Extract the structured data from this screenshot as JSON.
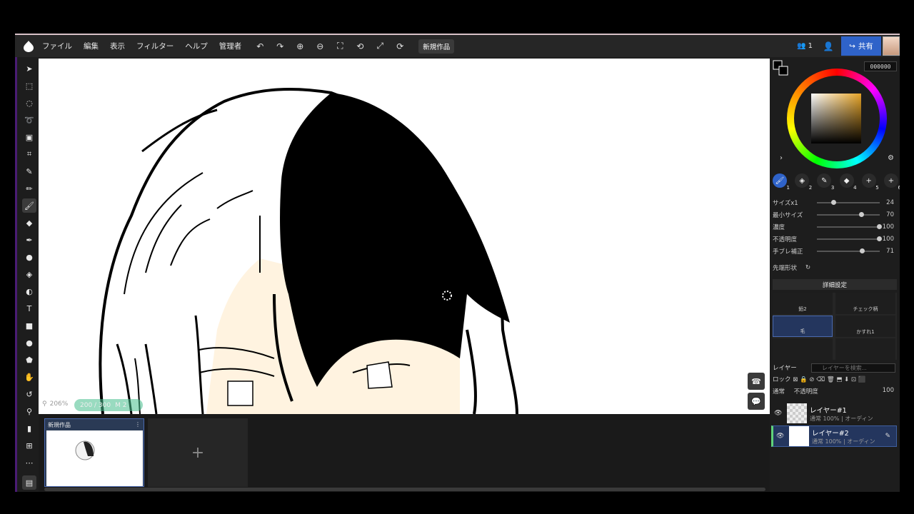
{
  "menu": {
    "items": [
      "ファイル",
      "編集",
      "表示",
      "フィルター",
      "ヘルプ",
      "管理者"
    ],
    "doc_title": "新規作品"
  },
  "header": {
    "user_count": "1",
    "share_label": "共有"
  },
  "canvas": {
    "zoom": "206%",
    "brush_size_pill": "200 / 300",
    "brush_mode": "M 2"
  },
  "works": {
    "thumb_title": "新規作品",
    "add_label": "+"
  },
  "color": {
    "hex": "000000",
    "accent": "#2f63c9"
  },
  "brush_tabs": [
    {
      "icon": "brush-icon",
      "num": "1"
    },
    {
      "icon": "fill-icon",
      "num": "2"
    },
    {
      "icon": "pen-icon",
      "num": "3"
    },
    {
      "icon": "eraser-icon",
      "num": "4"
    },
    {
      "icon": "add-icon",
      "num": "5"
    },
    {
      "icon": "add-icon",
      "num": "6"
    }
  ],
  "sliders": [
    {
      "label": "サイズx1",
      "value": "24",
      "level": 0.24
    },
    {
      "label": "最小サイズ",
      "value": "70",
      "level": 0.7
    },
    {
      "label": "濃度",
      "value": "100",
      "level": 1.0
    },
    {
      "label": "不透明度",
      "value": "100",
      "level": 1.0
    },
    {
      "label": "手ブレ補正",
      "value": "71",
      "level": 0.71
    }
  ],
  "tip_label": "先端形状",
  "detail_label": "詳細設定",
  "brushes": [
    "鉛2",
    "チェック柄",
    "毛",
    "かすれ1"
  ],
  "layers_panel": {
    "title": "レイヤー",
    "search_placeholder": "レイヤーを検索...",
    "lock_label": "ロック",
    "blend_mode": "通常",
    "opacity_label": "不透明度",
    "opacity_value": "100",
    "layers": [
      {
        "name": "レイヤー#1",
        "sub": "通常 100% | オーディン"
      },
      {
        "name": "レイヤー#2",
        "sub": "通常 100% | オーディン"
      }
    ]
  }
}
